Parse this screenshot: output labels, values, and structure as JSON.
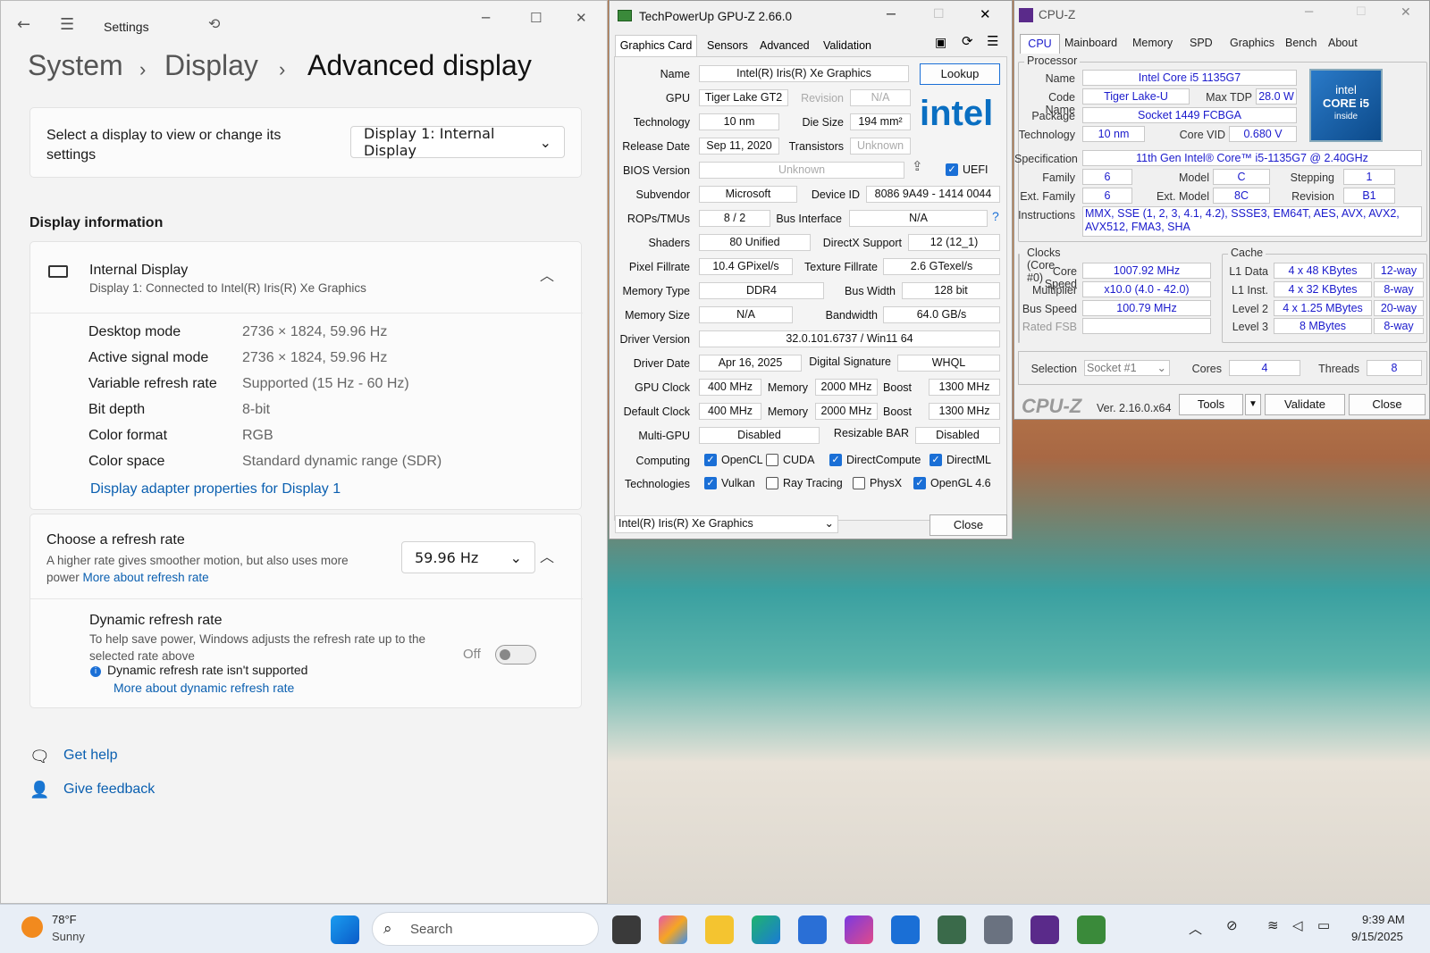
{
  "settings": {
    "title": "Settings",
    "breadcrumb": [
      "System",
      "Display",
      "Advanced display"
    ],
    "select_display_label": "Select a display to view or change its settings",
    "select_display_value": "Display 1: Internal Display",
    "section_title": "Display information",
    "display_name": "Internal Display",
    "display_sub": "Display 1: Connected to Intel(R) Iris(R) Xe Graphics",
    "info": [
      {
        "k": "Desktop mode",
        "v": "2736 × 1824, 59.96 Hz"
      },
      {
        "k": "Active signal mode",
        "v": "2736 × 1824, 59.96 Hz"
      },
      {
        "k": "Variable refresh rate",
        "v": "Supported (15 Hz - 60 Hz)"
      },
      {
        "k": "Bit depth",
        "v": "8-bit"
      },
      {
        "k": "Color format",
        "v": "RGB"
      },
      {
        "k": "Color space",
        "v": "Standard dynamic range (SDR)"
      }
    ],
    "adapter_link": "Display adapter properties for Display 1",
    "refresh_title": "Choose a refresh rate",
    "refresh_desc": "A higher rate gives smoother motion, but also uses more power",
    "refresh_link": "More about refresh rate",
    "refresh_value": "59.96 Hz",
    "dyn_title": "Dynamic refresh rate",
    "dyn_desc": "To help save power, Windows adjusts the refresh rate up to the selected rate above",
    "dyn_toggle": "Off",
    "dyn_note": "Dynamic refresh rate isn't supported",
    "dyn_link": "More about dynamic refresh rate",
    "help": "Get help",
    "feedback": "Give feedback"
  },
  "gpuz": {
    "title": "TechPowerUp GPU-Z 2.66.0",
    "tabs": [
      "Graphics Card",
      "Sensors",
      "Advanced",
      "Validation"
    ],
    "lookup": "Lookup",
    "logo": "intel",
    "uefi": "UEFI",
    "rows": {
      "name_l": "Name",
      "name": "Intel(R) Iris(R) Xe Graphics",
      "gpu_l": "GPU",
      "gpu": "Tiger Lake GT2",
      "rev_l": "Revision",
      "rev": "N/A",
      "tech_l": "Technology",
      "tech": "10 nm",
      "die_l": "Die Size",
      "die": "194 mm²",
      "rel_l": "Release Date",
      "rel": "Sep 11, 2020",
      "tr_l": "Transistors",
      "tr": "Unknown",
      "bios_l": "BIOS Version",
      "bios": "Unknown",
      "subv_l": "Subvendor",
      "subv": "Microsoft",
      "devid_l": "Device ID",
      "devid": "8086 9A49 - 1414 0044",
      "rops_l": "ROPs/TMUs",
      "rops": "8 / 2",
      "bus_l": "Bus Interface",
      "bus": "N/A",
      "sh_l": "Shaders",
      "sh": "80 Unified",
      "dx_l": "DirectX Support",
      "dx": "12 (12_1)",
      "pf_l": "Pixel Fillrate",
      "pf": "10.4 GPixel/s",
      "tf_l": "Texture Fillrate",
      "tf": "2.6 GTexel/s",
      "mt_l": "Memory Type",
      "mt": "DDR4",
      "bw_l": "Bus Width",
      "bw": "128 bit",
      "ms_l": "Memory Size",
      "ms": "N/A",
      "band_l": "Bandwidth",
      "band": "64.0 GB/s",
      "drv_l": "Driver Version",
      "drv": "32.0.101.6737 / Win11 64",
      "dd_l": "Driver Date",
      "dd": "Apr 16, 2025",
      "sig_l": "Digital Signature",
      "sig": "WHQL",
      "gc_l": "GPU Clock",
      "gc": "400 MHz",
      "mem_l": "Memory",
      "gcm": "2000 MHz",
      "boost_l": "Boost",
      "gcb": "1300 MHz",
      "dc_l": "Default Clock",
      "dc": "400 MHz",
      "dcm": "2000 MHz",
      "dcb": "1300 MHz",
      "mg_l": "Multi-GPU",
      "mg": "Disabled",
      "rb_l": "Resizable BAR",
      "rb": "Disabled",
      "comp_l": "Computing",
      "techs_l": "Technologies"
    },
    "computing": [
      {
        "t": "OpenCL",
        "on": true
      },
      {
        "t": "CUDA",
        "on": false
      },
      {
        "t": "DirectCompute",
        "on": true
      },
      {
        "t": "DirectML",
        "on": true
      }
    ],
    "technologies": [
      {
        "t": "Vulkan",
        "on": true
      },
      {
        "t": "Ray Tracing",
        "on": false
      },
      {
        "t": "PhysX",
        "on": false
      },
      {
        "t": "OpenGL 4.6",
        "on": true
      }
    ],
    "select": "Intel(R) Iris(R) Xe Graphics",
    "close": "Close"
  },
  "cpuz": {
    "title": "CPU-Z",
    "tabs": [
      "CPU",
      "Mainboard",
      "Memory",
      "SPD",
      "Graphics",
      "Bench",
      "About"
    ],
    "processor": "Processor",
    "name_l": "Name",
    "name": "Intel Core i5 1135G7",
    "code_l": "Code Name",
    "code": "Tiger Lake-U",
    "tdp_l": "Max TDP",
    "tdp": "28.0 W",
    "pkg_l": "Package",
    "pkg": "Socket 1449 FCBGA",
    "tech_l": "Technology",
    "tech": "10 nm",
    "vid_l": "Core VID",
    "vid": "0.680 V",
    "spec_l": "Specification",
    "spec": "11th Gen Intel® Core™ i5-1135G7 @ 2.40GHz",
    "fam_l": "Family",
    "fam": "6",
    "mod_l": "Model",
    "mod": "C",
    "step_l": "Stepping",
    "step": "1",
    "efam_l": "Ext. Family",
    "efam": "6",
    "emod_l": "Ext. Model",
    "emod": "8C",
    "rev_l": "Revision",
    "rev": "B1",
    "ins_l": "Instructions",
    "ins": "MMX, SSE (1, 2, 3, 4.1, 4.2), SSSE3, EM64T, AES, AVX, AVX2, AVX512, FMA3, SHA",
    "clocks": "Clocks (Core #0)",
    "cache": "Cache",
    "cs_l": "Core Speed",
    "cs": "1007.92 MHz",
    "mul_l": "Multiplier",
    "mul": "x10.0 (4.0 - 42.0)",
    "bs_l": "Bus Speed",
    "bs": "100.79 MHz",
    "fsb_l": "Rated FSB",
    "l1d_l": "L1 Data",
    "l1d": "4 x 48 KBytes",
    "l1dw": "12-way",
    "l1i_l": "L1 Inst.",
    "l1i": "4 x 32 KBytes",
    "l1iw": "8-way",
    "l2_l": "Level 2",
    "l2": "4 x 1.25 MBytes",
    "l2w": "20-way",
    "l3_l": "Level 3",
    "l3": "8 MBytes",
    "l3w": "8-way",
    "sel_l": "Selection",
    "sel": "Socket #1",
    "cores_l": "Cores",
    "cores": "4",
    "thr_l": "Threads",
    "thr": "8",
    "brand": "CPU-Z",
    "ver": "Ver. 2.16.0.x64",
    "tools": "Tools",
    "validate": "Validate",
    "close": "Close",
    "badge": [
      "intel",
      "CORE i5",
      "inside"
    ]
  },
  "taskbar": {
    "temp": "78°F",
    "weather": "Sunny",
    "search": "Search",
    "time": "9:39 AM",
    "date": "9/15/2025"
  }
}
